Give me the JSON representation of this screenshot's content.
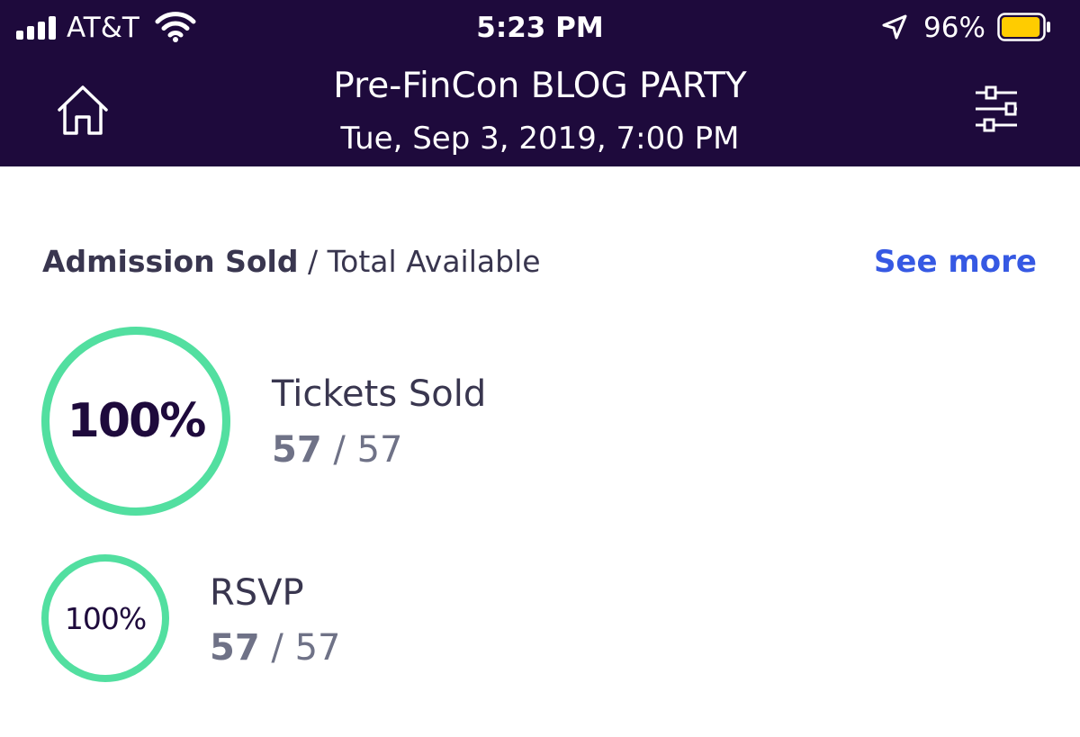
{
  "status_bar": {
    "carrier": "AT&T",
    "time": "5:23 PM",
    "battery_percent": "96%",
    "icons": [
      "signal-icon",
      "wifi-icon",
      "location-icon",
      "battery-icon"
    ],
    "battery_level": 0.96,
    "battery_color": "#ffcc00"
  },
  "nav": {
    "title": "Pre-FinCon BLOG PARTY",
    "subtitle": "Tue, Sep 3, 2019, 7:00 PM",
    "left_icon": "home-icon",
    "right_icon": "filter-sliders-icon"
  },
  "section": {
    "title_strong": "Admission Sold",
    "title_separator": "/",
    "title_rest": "Total Available",
    "see_more": "See more"
  },
  "metrics": [
    {
      "ring_label": "100%",
      "label": "Tickets Sold",
      "sold": "57",
      "separator": "/",
      "total": "57",
      "progress": 1.0
    },
    {
      "ring_label": "100%",
      "label": "RSVP",
      "sold": "57",
      "separator": "/",
      "total": "57",
      "progress": 1.0
    }
  ],
  "colors": {
    "header_bg": "#1e0a3c",
    "ring": "#52dfa0",
    "link": "#3659e3",
    "text_dark": "#39364f",
    "text_muted": "#6f7287"
  }
}
